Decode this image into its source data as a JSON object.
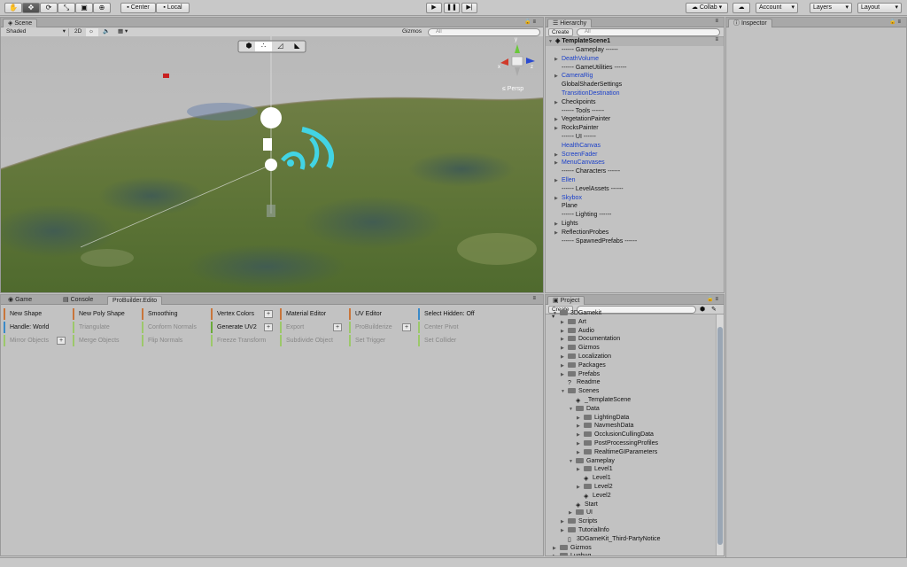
{
  "toolbar": {
    "tools": [
      "hand-tool",
      "move-tool",
      "rotate-tool",
      "scale-tool",
      "rect-tool",
      "transform-tool"
    ],
    "pivot_mode": "Center",
    "pivot_rotation": "Local",
    "collab": "Collab",
    "account": "Account",
    "layers": "Layers",
    "layout": "Layout"
  },
  "scene": {
    "tab": "Scene",
    "shading": "Shaded",
    "mode_2d": "2D",
    "gizmos": "Gizmos",
    "search_placeholder": "All",
    "persp_label": "Persp",
    "gizmo_axes": {
      "x": "x",
      "y": "y",
      "z": "z"
    }
  },
  "hierarchy": {
    "tab": "Hierarchy",
    "create": "Create",
    "search_placeholder": "All",
    "root": "TemplateScene1",
    "items": [
      {
        "label": "------ Gameplay ------",
        "arrow": false,
        "blue": false
      },
      {
        "label": "DeathVolume",
        "arrow": true,
        "blue": true
      },
      {
        "label": "------ GameUtilities ------",
        "arrow": false,
        "blue": false
      },
      {
        "label": "CameraRig",
        "arrow": true,
        "blue": true
      },
      {
        "label": "GlobalShaderSettings",
        "arrow": false,
        "blue": false
      },
      {
        "label": "TransitionDestination",
        "arrow": false,
        "blue": true
      },
      {
        "label": "Checkpoints",
        "arrow": true,
        "blue": false
      },
      {
        "label": "------ Tools ------",
        "arrow": false,
        "blue": false
      },
      {
        "label": "VegetationPainter",
        "arrow": true,
        "blue": false
      },
      {
        "label": "RocksPainter",
        "arrow": true,
        "blue": false
      },
      {
        "label": "------ UI ------",
        "arrow": false,
        "blue": false
      },
      {
        "label": "HealthCanvas",
        "arrow": false,
        "blue": true
      },
      {
        "label": "ScreenFader",
        "arrow": true,
        "blue": true
      },
      {
        "label": "MenuCanvases",
        "arrow": true,
        "blue": true
      },
      {
        "label": "------ Characters ------",
        "arrow": false,
        "blue": false
      },
      {
        "label": "Ellen",
        "arrow": true,
        "blue": true
      },
      {
        "label": "------ LevelAssets ------",
        "arrow": false,
        "blue": false
      },
      {
        "label": "Skybox",
        "arrow": true,
        "blue": true
      },
      {
        "label": "Plane",
        "arrow": false,
        "blue": false
      },
      {
        "label": "------ Lighting ------",
        "arrow": false,
        "blue": false
      },
      {
        "label": "Lights",
        "arrow": true,
        "blue": false
      },
      {
        "label": "ReflectionProbes",
        "arrow": true,
        "blue": false
      },
      {
        "label": "------ SpawnedPrefabs ------",
        "arrow": false,
        "blue": false
      }
    ]
  },
  "inspector": {
    "tab": "Inspector"
  },
  "bottom_tabs": [
    "Game",
    "Console",
    "ProBuilder.Edito"
  ],
  "probuilder": {
    "rows": [
      [
        {
          "label": "New Shape",
          "color": "#c8753a",
          "dim": false
        },
        {
          "label": "New Poly Shape",
          "color": "#c8753a",
          "dim": false
        },
        {
          "label": "Smoothing",
          "color": "#c8753a",
          "dim": false
        },
        {
          "label": "Vertex Colors",
          "color": "#c8753a",
          "dim": false,
          "plus": true
        },
        {
          "label": "Material Editor",
          "color": "#c8753a",
          "dim": false
        },
        {
          "label": "UV Editor",
          "color": "#c8753a",
          "dim": false
        },
        {
          "label": "Select Hidden: Off",
          "color": "#3a8ac8",
          "dim": false
        }
      ],
      [
        {
          "label": "Handle: World",
          "color": "#3a8ac8",
          "dim": false
        },
        {
          "label": "Triangulate",
          "color": "#9cc86a",
          "dim": true
        },
        {
          "label": "Conform Normals",
          "color": "#9cc86a",
          "dim": true
        },
        {
          "label": "Generate UV2",
          "color": "#6aaa3a",
          "dim": false,
          "plus": true
        },
        {
          "label": "Export",
          "color": "#9cc86a",
          "dim": true,
          "plus": true
        },
        {
          "label": "ProBuilderize",
          "color": "#9cc86a",
          "dim": true,
          "plus": true
        },
        {
          "label": "Center Pivot",
          "color": "#9cc86a",
          "dim": true
        }
      ],
      [
        {
          "label": "Mirror Objects",
          "color": "#9cc86a",
          "dim": true,
          "plus": true
        },
        {
          "label": "Merge Objects",
          "color": "#9cc86a",
          "dim": true
        },
        {
          "label": "Flip Normals",
          "color": "#9cc86a",
          "dim": true
        },
        {
          "label": "Freeze Transform",
          "color": "#9cc86a",
          "dim": true
        },
        {
          "label": "Subdivide Object",
          "color": "#9cc86a",
          "dim": true
        },
        {
          "label": "Set Trigger",
          "color": "#9cc86a",
          "dim": true
        },
        {
          "label": "Set Collider",
          "color": "#9cc86a",
          "dim": true
        }
      ]
    ]
  },
  "project": {
    "tab": "Project",
    "create": "Create",
    "items": [
      {
        "label": "3DGamekit",
        "depth": 0,
        "arrow": "open",
        "icon": "folder"
      },
      {
        "label": "Art",
        "depth": 1,
        "arrow": "closed",
        "icon": "folder"
      },
      {
        "label": "Audio",
        "depth": 1,
        "arrow": "closed",
        "icon": "folder"
      },
      {
        "label": "Documentation",
        "depth": 1,
        "arrow": "closed",
        "icon": "folder"
      },
      {
        "label": "Gizmos",
        "depth": 1,
        "arrow": "closed",
        "icon": "folder"
      },
      {
        "label": "Localization",
        "depth": 1,
        "arrow": "closed",
        "icon": "folder"
      },
      {
        "label": "Packages",
        "depth": 1,
        "arrow": "closed",
        "icon": "folder"
      },
      {
        "label": "Prefabs",
        "depth": 1,
        "arrow": "closed",
        "icon": "folder"
      },
      {
        "label": "Readme",
        "depth": 1,
        "arrow": "none",
        "icon": "question"
      },
      {
        "label": "Scenes",
        "depth": 1,
        "arrow": "open",
        "icon": "folder"
      },
      {
        "label": "_TemplateScene",
        "depth": 2,
        "arrow": "none",
        "icon": "unity"
      },
      {
        "label": "Data",
        "depth": 2,
        "arrow": "open",
        "icon": "folder"
      },
      {
        "label": "LightingData",
        "depth": 3,
        "arrow": "closed",
        "icon": "folder"
      },
      {
        "label": "NavmeshData",
        "depth": 3,
        "arrow": "closed",
        "icon": "folder"
      },
      {
        "label": "OcclusionCullingData",
        "depth": 3,
        "arrow": "closed",
        "icon": "folder"
      },
      {
        "label": "PostProcessingProfiles",
        "depth": 3,
        "arrow": "closed",
        "icon": "folder"
      },
      {
        "label": "RealtimeGIParameters",
        "depth": 3,
        "arrow": "closed",
        "icon": "folder"
      },
      {
        "label": "Gameplay",
        "depth": 2,
        "arrow": "open",
        "icon": "folder"
      },
      {
        "label": "Level1",
        "depth": 3,
        "arrow": "closed",
        "icon": "folder"
      },
      {
        "label": "Level1",
        "depth": 3,
        "arrow": "none",
        "icon": "unity"
      },
      {
        "label": "Level2",
        "depth": 3,
        "arrow": "closed",
        "icon": "folder"
      },
      {
        "label": "Level2",
        "depth": 3,
        "arrow": "none",
        "icon": "unity"
      },
      {
        "label": "Start",
        "depth": 2,
        "arrow": "none",
        "icon": "unity"
      },
      {
        "label": "UI",
        "depth": 2,
        "arrow": "closed",
        "icon": "folder"
      },
      {
        "label": "Scripts",
        "depth": 1,
        "arrow": "closed",
        "icon": "folder"
      },
      {
        "label": "TutorialInfo",
        "depth": 1,
        "arrow": "closed",
        "icon": "folder"
      },
      {
        "label": "3DGameKit_Third-PartyNotice",
        "depth": 1,
        "arrow": "none",
        "icon": "doc"
      },
      {
        "label": "Gizmos",
        "depth": 0,
        "arrow": "closed",
        "icon": "folder"
      },
      {
        "label": "Lugbug",
        "depth": 0,
        "arrow": "closed",
        "icon": "folder"
      }
    ]
  }
}
